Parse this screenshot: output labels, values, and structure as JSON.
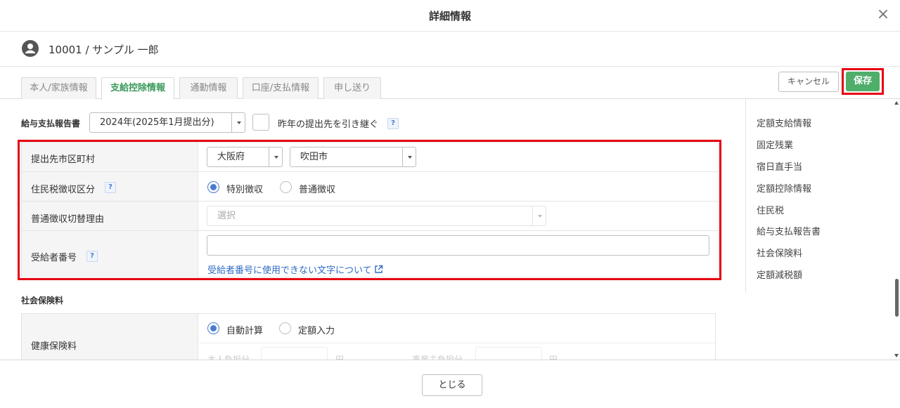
{
  "header": {
    "title": "詳細情報",
    "close_glyph": "×"
  },
  "employee": {
    "name": "10001 / サンプル 一郎",
    "avatar_icon": "user-circle-icon"
  },
  "tabs": [
    {
      "label": "本人/家族情報"
    },
    {
      "label": "支給控除情報"
    },
    {
      "label": "通勤情報"
    },
    {
      "label": "口座/支払情報"
    },
    {
      "label": "申し送り"
    }
  ],
  "actions": {
    "cancel_label": "キャンセル",
    "save_label": "保存"
  },
  "report": {
    "label": "給与支払報告書",
    "year_value": "2024年(2025年1月提出分)",
    "inherit_label": "昨年の提出先を引き継ぐ",
    "help": "?"
  },
  "form": {
    "municipality_label": "提出先市区町村",
    "prefecture_value": "大阪府",
    "city_value": "吹田市",
    "tax_method_label": "住民税徴収区分",
    "tax_method_options": [
      "特別徴収",
      "普通徴収"
    ],
    "switch_reason_label": "普通徴収切替理由",
    "switch_reason_placeholder": "選択",
    "recipient_no_label": "受給者番号",
    "recipient_no_value": "",
    "recipient_no_link": "受給者番号に使用できない文字について",
    "help": "?"
  },
  "insurance": {
    "section_label": "社会保険料",
    "health_label": "健康保険料",
    "calc_options": [
      "自動計算",
      "定額入力"
    ],
    "self_share_label": "本人負担分",
    "employer_share_label": "事業主負担分",
    "yen": "円"
  },
  "sidebar": {
    "items": [
      {
        "label": "定額支給情報"
      },
      {
        "label": "固定残業"
      },
      {
        "label": "宿日直手当"
      },
      {
        "label": "定額控除情報"
      },
      {
        "label": "住民税"
      },
      {
        "label": "給与支払報告書"
      },
      {
        "label": "社会保険料"
      },
      {
        "label": "定額減税額"
      }
    ]
  },
  "footer": {
    "close_label": "とじる"
  },
  "colors": {
    "accent_green": "#4fae6a",
    "highlight_red": "#e60012",
    "link_blue": "#2f6cc4"
  }
}
